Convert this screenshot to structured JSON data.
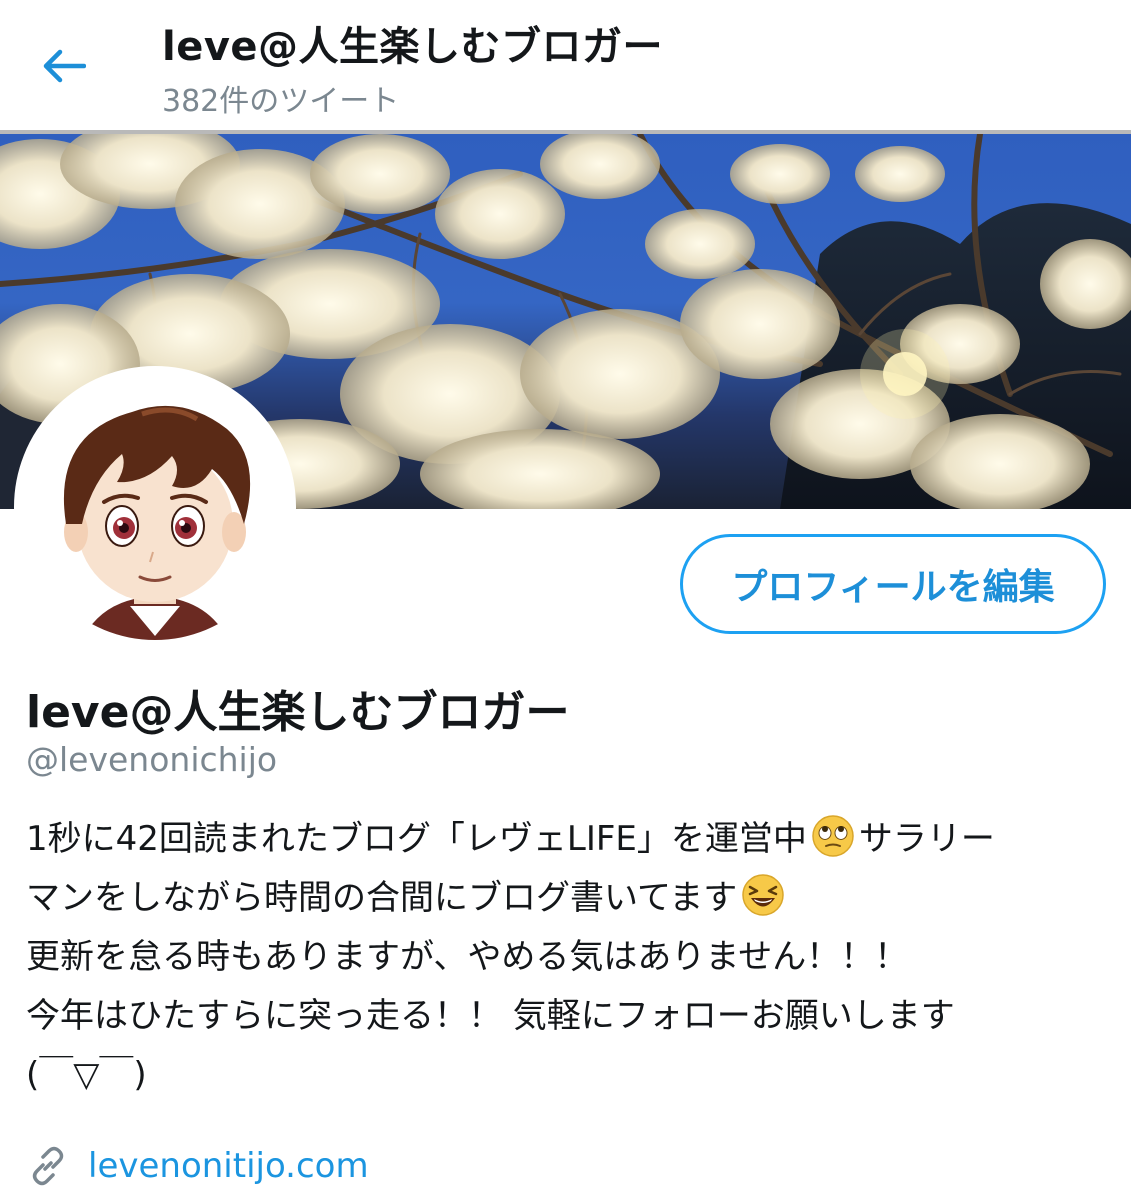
{
  "header": {
    "title": "leve@人生楽しむブロガー",
    "subtitle": "382件のツイート"
  },
  "profile": {
    "edit_button": "プロフィールを編集",
    "display_name": "leve@人生楽しむブロガー",
    "handle": "@levenonichijo",
    "bio": {
      "line1_a": "1秒に42回読まれたブログ「レヴェLIFE」を運営中",
      "line1_b": "サラリー",
      "line2": "マンをしながら時間の合間にブログ書いてます",
      "line3": "更新を怠る時もありますが、やめる気はありません！！！",
      "line4": "今年はひたすらに突っ走る！！ 気軽にフォローお願いします",
      "line5": "(￣▽￣)"
    },
    "website": "levenonitijo.com"
  },
  "icons": {
    "back": "arrow-left-icon",
    "link": "link-icon",
    "emoji1": "rolling-eyes-emoji",
    "emoji2": "laughing-emoji"
  },
  "colors": {
    "accent": "#1da1f2",
    "link": "#1b95e0",
    "muted": "#7b8790"
  }
}
